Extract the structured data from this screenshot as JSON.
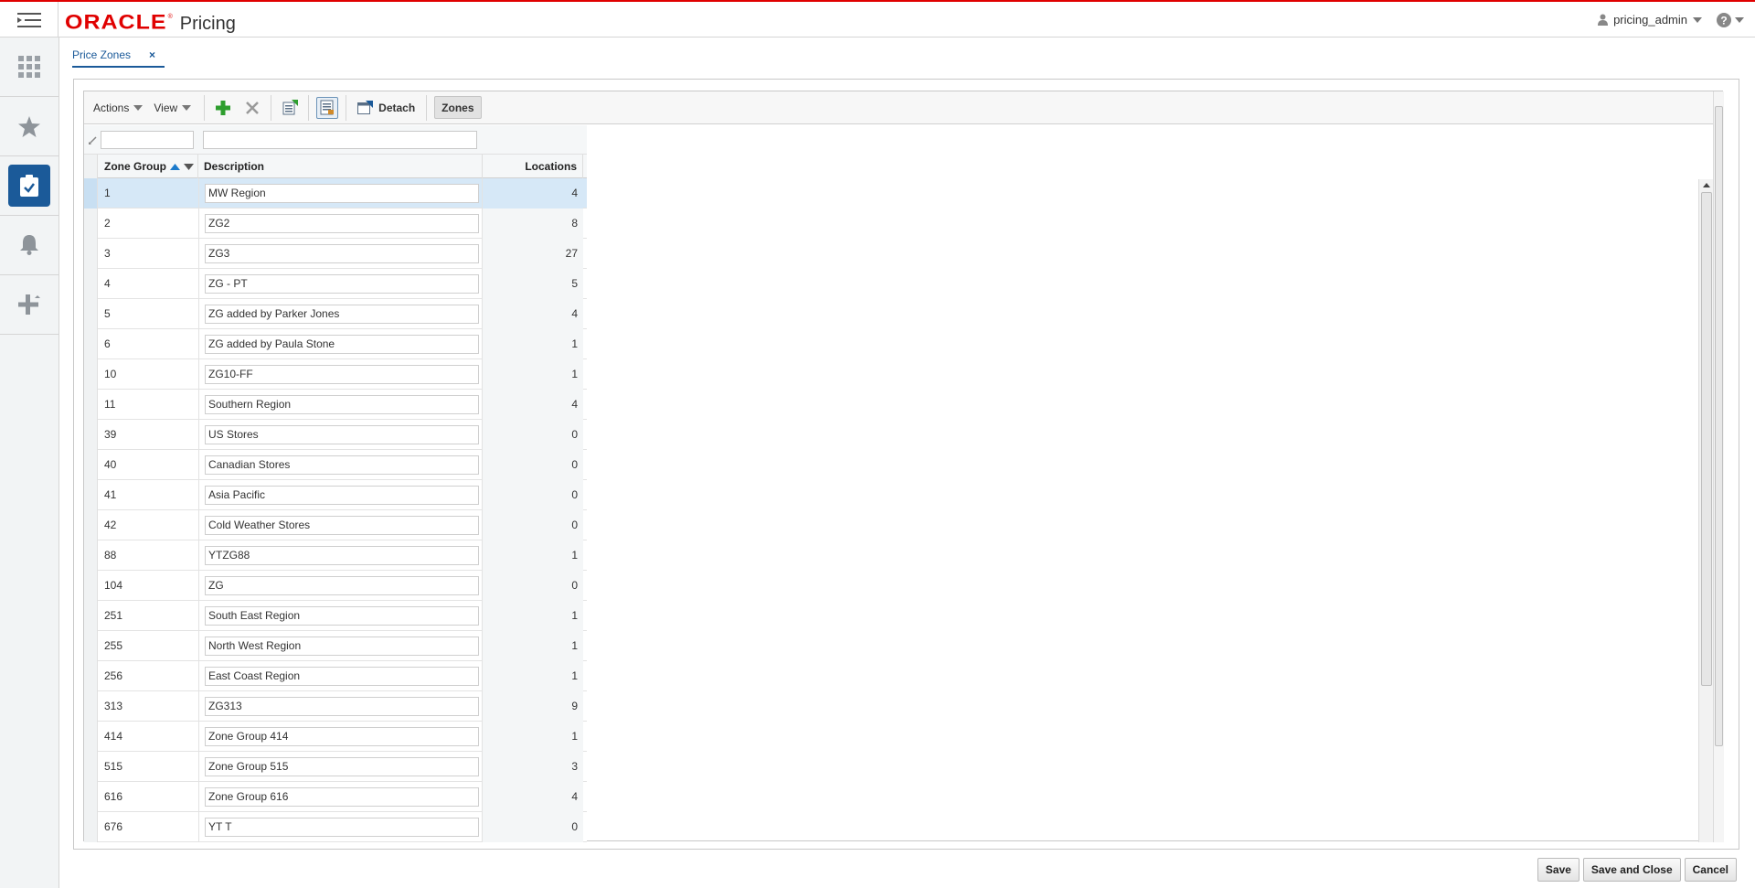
{
  "header": {
    "brand": "ORACLE",
    "app_name": "Pricing",
    "user": "pricing_admin"
  },
  "tab": {
    "label": "Price Zones",
    "close": "×"
  },
  "toolbar": {
    "actions_label": "Actions",
    "view_label": "View",
    "detach_label": "Detach",
    "zones_label": "Zones"
  },
  "table": {
    "columns": [
      "Zone Group",
      "Description",
      "Locations"
    ],
    "rows": [
      {
        "id": "1",
        "desc": "MW Region",
        "loc": "4"
      },
      {
        "id": "2",
        "desc": "ZG2",
        "loc": "8"
      },
      {
        "id": "3",
        "desc": "ZG3",
        "loc": "27"
      },
      {
        "id": "4",
        "desc": "ZG - PT",
        "loc": "5"
      },
      {
        "id": "5",
        "desc": "ZG added by Parker Jones",
        "loc": "4"
      },
      {
        "id": "6",
        "desc": "ZG added by Paula Stone",
        "loc": "1"
      },
      {
        "id": "10",
        "desc": "ZG10-FF",
        "loc": "1"
      },
      {
        "id": "11",
        "desc": "Southern Region",
        "loc": "4"
      },
      {
        "id": "39",
        "desc": "US Stores",
        "loc": "0"
      },
      {
        "id": "40",
        "desc": "Canadian Stores",
        "loc": "0"
      },
      {
        "id": "41",
        "desc": "Asia Pacific",
        "loc": "0"
      },
      {
        "id": "42",
        "desc": "Cold Weather Stores",
        "loc": "0"
      },
      {
        "id": "88",
        "desc": "YTZG88",
        "loc": "1"
      },
      {
        "id": "104",
        "desc": "ZG",
        "loc": "0"
      },
      {
        "id": "251",
        "desc": "South East Region",
        "loc": "1"
      },
      {
        "id": "255",
        "desc": "North West Region",
        "loc": "1"
      },
      {
        "id": "256",
        "desc": "East Coast Region",
        "loc": "1"
      },
      {
        "id": "313",
        "desc": "ZG313",
        "loc": "9"
      },
      {
        "id": "414",
        "desc": "Zone Group 414",
        "loc": "1"
      },
      {
        "id": "515",
        "desc": "Zone Group 515",
        "loc": "3"
      },
      {
        "id": "616",
        "desc": "Zone Group 616",
        "loc": "4"
      },
      {
        "id": "676",
        "desc": "YT T",
        "loc": "0"
      }
    ]
  },
  "footer": {
    "save": "Save",
    "save_close": "Save and Close",
    "cancel": "Cancel"
  },
  "colors": {
    "brand_red": "#e00000",
    "accent_blue": "#1b5a99"
  },
  "icons": [
    "menu-icon",
    "grid-icon",
    "star-icon",
    "tasks-icon",
    "bell-icon",
    "plus-arrows-icon",
    "user-icon",
    "help-icon",
    "add-icon",
    "delete-icon",
    "export-icon",
    "freeze-icon",
    "detach-icon"
  ]
}
